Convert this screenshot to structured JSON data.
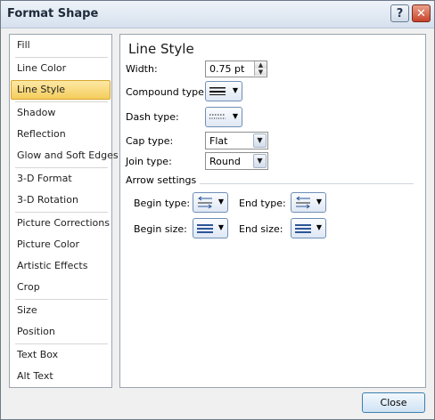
{
  "window": {
    "title": "Format Shape",
    "help_glyph": "?",
    "close_glyph": "✕"
  },
  "sidebar": {
    "items": [
      {
        "label": "Fill"
      },
      {
        "label": "Line Color"
      },
      {
        "label": "Line Style",
        "selected": true
      },
      {
        "label": "Shadow"
      },
      {
        "label": "Reflection"
      },
      {
        "label": "Glow and Soft Edges"
      },
      {
        "label": "3-D Format"
      },
      {
        "label": "3-D Rotation"
      },
      {
        "label": "Picture Corrections"
      },
      {
        "label": "Picture Color"
      },
      {
        "label": "Artistic Effects"
      },
      {
        "label": "Crop"
      },
      {
        "label": "Size"
      },
      {
        "label": "Position"
      },
      {
        "label": "Text Box"
      },
      {
        "label": "Alt Text"
      }
    ]
  },
  "panel": {
    "title": "Line Style",
    "width": {
      "label": "Width:",
      "value": "0.75 pt"
    },
    "compound_type": {
      "label": "Compound type:"
    },
    "dash_type": {
      "label": "Dash type:"
    },
    "cap_type": {
      "label": "Cap type:",
      "value": "Flat"
    },
    "join_type": {
      "label": "Join type:",
      "value": "Round"
    },
    "arrow_settings": {
      "label": "Arrow settings",
      "begin_type": {
        "label": "Begin type:"
      },
      "end_type": {
        "label": "End type:"
      },
      "begin_size": {
        "label": "Begin size:"
      },
      "end_size": {
        "label": "End size:"
      }
    }
  },
  "footer": {
    "close_label": "Close"
  },
  "colors": {
    "selection_fill": "#f5cd5d",
    "accent_border": "#3c7fb1",
    "close_red": "#c8432c"
  }
}
